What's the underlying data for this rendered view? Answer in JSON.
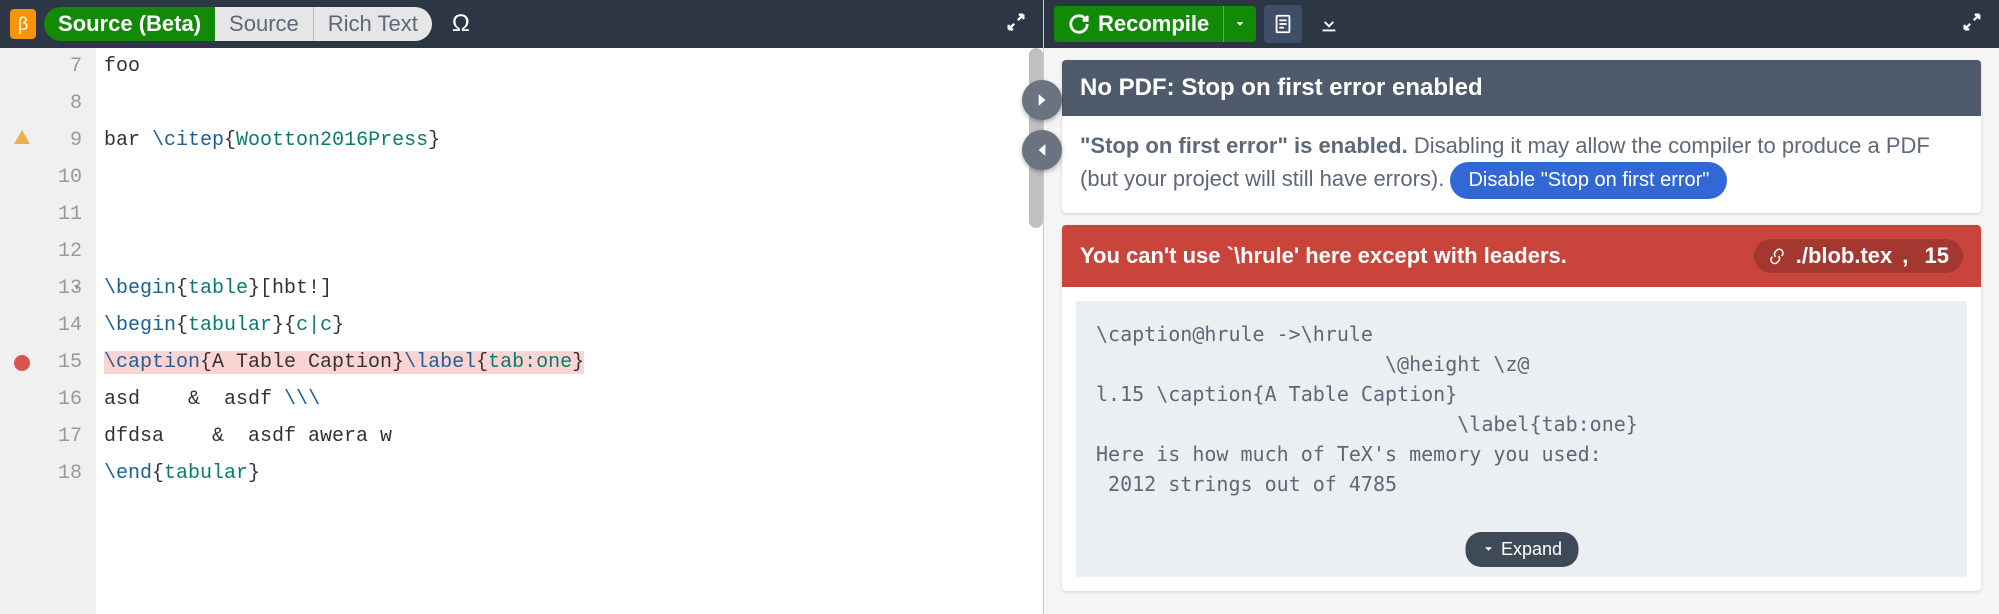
{
  "left_toolbar": {
    "beta_badge": "β",
    "source_beta": "Source (Beta)",
    "source": "Source",
    "rich_text": "Rich Text",
    "omega": "Ω"
  },
  "editor": {
    "lines": [
      {
        "num": 7,
        "content": "foo"
      },
      {
        "num": 8,
        "content": ""
      },
      {
        "num": 9,
        "content": "bar \\citep{Wootton2016Press}",
        "mark": "warn"
      },
      {
        "num": 10,
        "content": ""
      },
      {
        "num": 11,
        "content": ""
      },
      {
        "num": 12,
        "content": ""
      },
      {
        "num": 13,
        "content": "\\begin{table}[hbt!]",
        "fold": true
      },
      {
        "num": 14,
        "content": "\\begin{tabular}{c|c}"
      },
      {
        "num": 15,
        "content": "\\caption{A Table Caption}\\label{tab:one}",
        "mark": "err",
        "hl": true
      },
      {
        "num": 16,
        "content": "asd    &  asdf \\\\\\"
      },
      {
        "num": 17,
        "content": "dfdsa    &  asdf awera w"
      },
      {
        "num": 18,
        "content": "\\end{tabular}"
      }
    ]
  },
  "right_toolbar": {
    "recompile": "Recompile"
  },
  "nopdf": {
    "title": "No PDF: Stop on first error enabled",
    "bold": "\"Stop on first error\" is enabled.",
    "rest": " Disabling it may allow the compiler to produce a PDF (but your project will still have errors). ",
    "button": "Disable \"Stop on first error\""
  },
  "error": {
    "title": "You can't use `\\hrule' here except with leaders.",
    "file": "./blob.tex",
    "line": "15",
    "body": "\\caption@hrule ->\\hrule \n                        \\@height \\z@ \nl.15 \\caption{A Table Caption}\n                              \\label{tab:one}\nHere is how much of TeX's memory you used:\n 2012 strings out of 4785",
    "expand": "Expand"
  }
}
